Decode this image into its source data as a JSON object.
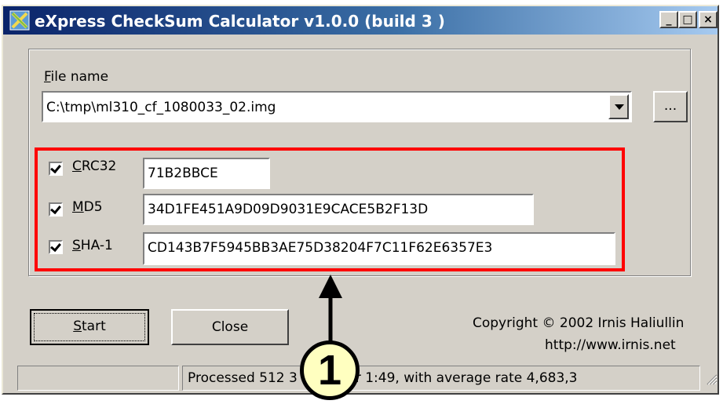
{
  "window": {
    "title": "eXpress CheckSum Calculator v1.0.0 (build 3 )",
    "controls": {
      "minimize": "_",
      "maximize": "□",
      "close": "×"
    }
  },
  "file": {
    "label_first": "F",
    "label_rest": "ile name",
    "path": "C:\\tmp\\ml310_cf_1080033_02.img",
    "browse_label": "..."
  },
  "checksums": [
    {
      "label_first": "C",
      "label_rest": "RC32",
      "checked": true,
      "value": "71B2BBCE"
    },
    {
      "label_first": "M",
      "label_rest": "D5",
      "checked": true,
      "value": "34D1FE451A9D09D9031E9CACE5B2F13D"
    },
    {
      "label_first": "S",
      "label_rest": "HA-1",
      "checked": true,
      "value": "CD143B7F5945BB3AE75D38204F7C11F62E6357E3"
    }
  ],
  "buttons": {
    "start_first": "S",
    "start_rest": "tart",
    "close": "Close"
  },
  "copyright": {
    "line1": "Copyright © 2002 Irnis Haliullin",
    "line2": "http://www.irnis.net"
  },
  "status": {
    "text": "Processed 512 3 bytes for 1:49, with average rate 4,683,3"
  },
  "annotation": {
    "number": "1"
  },
  "colors": {
    "title_start": "#0a246a",
    "title_end": "#a6caf0",
    "highlight": "#ff0000",
    "callout_fill": "#ffffc0"
  }
}
